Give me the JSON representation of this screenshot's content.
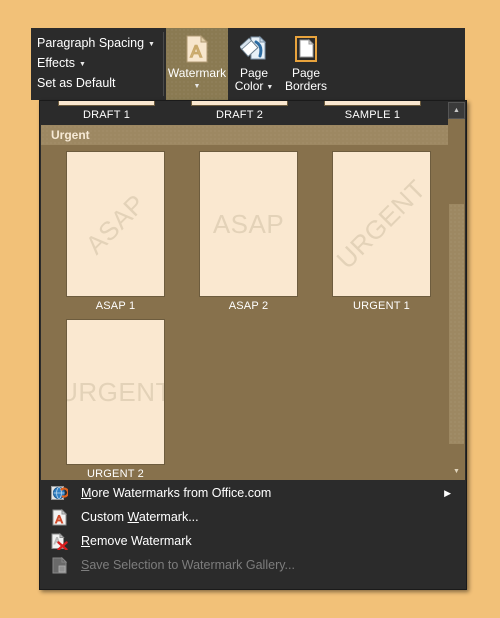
{
  "theme": {
    "outer_background": "#f2c178",
    "panel_background": "#2b2b2b",
    "gallery_background": "#87714c",
    "category_header_background": "#9d8862",
    "thumbnail_page": "#fae8d0",
    "watermark_text_color": "#e3d2b8",
    "active_button_background": "#8a7a52",
    "text_color": "#ffffff",
    "disabled_text_color": "#7d7d7d"
  },
  "ribbon": {
    "text_commands": [
      {
        "label": "Paragraph Spacing",
        "has_caret": true,
        "name": "paragraph-spacing"
      },
      {
        "label": "Effects",
        "has_caret": true,
        "name": "effects"
      },
      {
        "label": "Set as Default",
        "has_caret": false,
        "name": "set-as-default"
      }
    ],
    "buttons": [
      {
        "label": "Watermark",
        "icon": "watermark-document-icon",
        "active": true,
        "has_caret": true,
        "second_line": ""
      },
      {
        "label": "Page",
        "second_line": "Color",
        "icon": "paint-bucket-page-icon",
        "active": false,
        "has_caret": true
      },
      {
        "label": "Page",
        "second_line": "Borders",
        "icon": "page-borders-icon",
        "active": false,
        "has_caret": false
      }
    ]
  },
  "dropdown": {
    "top_partial_row": {
      "labels": [
        "DRAFT 1",
        "DRAFT 2",
        "SAMPLE 1"
      ]
    },
    "category": {
      "title": "Urgent"
    },
    "thumbnails": [
      {
        "label": "ASAP 1",
        "watermark_text": "ASAP",
        "orientation": "diagonal"
      },
      {
        "label": "ASAP 2",
        "watermark_text": "ASAP",
        "orientation": "horizontal"
      },
      {
        "label": "URGENT 1",
        "watermark_text": "URGENT",
        "orientation": "diagonal"
      },
      {
        "label": "URGENT 2",
        "watermark_text": "URGENT",
        "orientation": "horizontal"
      }
    ],
    "scrollbar": {
      "up_arrow_glyph": "▲",
      "down_arrow_glyph": "▼"
    },
    "menu_items": [
      {
        "label": "More Watermarks from Office.com",
        "accel": "M",
        "icon": "office-online-globe-icon",
        "disabled": false,
        "submenu_arrow": "▶"
      },
      {
        "label": "Custom Watermark...",
        "accel": "W",
        "icon": "custom-watermark-document-icon",
        "disabled": false,
        "submenu_arrow": ""
      },
      {
        "label": "Remove Watermark",
        "accel": "R",
        "icon": "remove-watermark-icon",
        "disabled": false,
        "submenu_arrow": ""
      },
      {
        "label": "Save Selection to Watermark Gallery...",
        "accel": "S",
        "icon": "save-selection-icon",
        "disabled": true,
        "submenu_arrow": ""
      }
    ]
  }
}
